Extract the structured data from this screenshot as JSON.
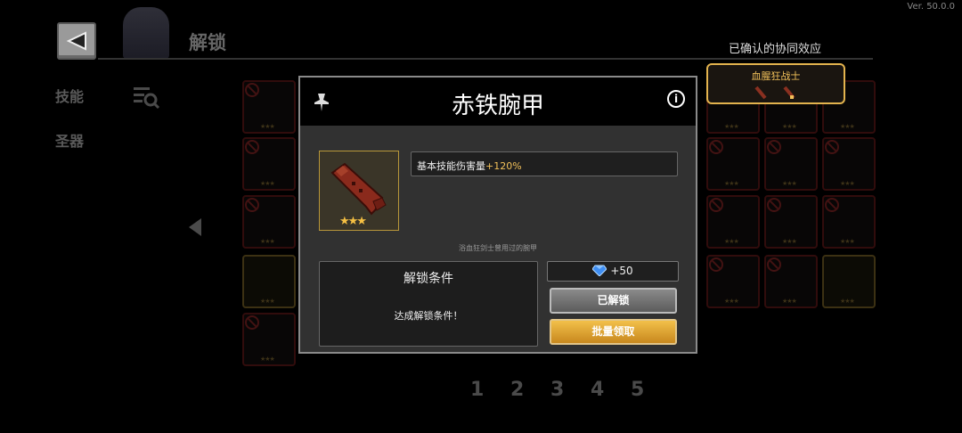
{
  "version": "Ver. 50.0.0",
  "header": {
    "title": "解锁"
  },
  "sidebar": {
    "items": [
      {
        "label": "技能"
      },
      {
        "label": "圣器"
      }
    ]
  },
  "synergy": {
    "title": "已确认的协同效应",
    "name": "血腥狂战士"
  },
  "grid": {
    "background_cell_stars": "★★★"
  },
  "pagination": {
    "pages": [
      "1",
      "2",
      "3",
      "4",
      "5"
    ]
  },
  "dialog": {
    "title": "赤铁腕甲",
    "item_stars": "★★★",
    "stat_label": "基本技能伤害量",
    "stat_value": "+120%",
    "description": "浴血狂剑士曾用过的腕甲",
    "condition_title": "解锁条件",
    "condition_text": "达成解锁条件！",
    "reward": "+50",
    "unlocked_label": "已解锁",
    "claim_label": "批量领取"
  },
  "icons": {
    "back": "back-arrow-icon",
    "filter": "filter-search-icon",
    "pin": "pin-icon",
    "info": "info-icon",
    "gem": "diamond-icon",
    "prev": "prev-page-arrow-icon"
  },
  "colors": {
    "accent_gold": "#f2c15a",
    "cell_border_red": "#5a1616",
    "dialog_bg": "#313131"
  }
}
